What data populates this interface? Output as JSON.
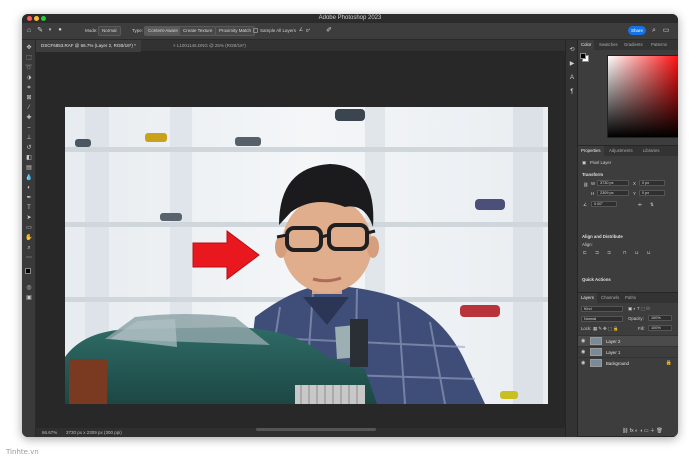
{
  "app": {
    "title": "Adobe Photoshop 2023"
  },
  "options_bar": {
    "mode_label": "Mode:",
    "mode_value": "Normal",
    "type_label": "Type:",
    "type_buttons": [
      "Content-Aware",
      "Create Texture",
      "Proximity Match"
    ],
    "sample_all_layers": "Sample All Layers",
    "angle_value": "0°",
    "share_label": "Share"
  },
  "doc_tabs": [
    {
      "label": "DSCF6853.RAF @ 66.7% (Layer 2, RGB/16*) *",
      "active": true
    },
    {
      "label": "L1001146.DNG @ 25% (RGB/16*)",
      "active": false
    }
  ],
  "status_bar": {
    "zoom": "66.67%",
    "doc_info": "3730 px x 2309 px (300 ppi)"
  },
  "color_panel": {
    "tabs": [
      "Color",
      "Swatches",
      "Gradients",
      "Patterns"
    ],
    "active_tab": "Color",
    "hue_colors": [
      "#ff0000",
      "#ff00ff",
      "#0000ff",
      "#00ffff",
      "#00ff00",
      "#ffff00",
      "#ff0000"
    ],
    "base_color": "#ff0000"
  },
  "properties_panel": {
    "tabs": [
      "Properties",
      "Adjustments",
      "Libraries"
    ],
    "active_tab": "Properties",
    "layer_type": "Pixel Layer",
    "transform_title": "Transform",
    "w_label": "W",
    "w_value": "3730 px",
    "h_label": "H",
    "h_value": "2309 px",
    "x_label": "X",
    "x_value": "0 px",
    "y_label": "Y",
    "y_value": "0 px",
    "angle_value": "0.00°",
    "align_title": "Align and Distribute",
    "align_label": "Align:",
    "quick_actions_title": "Quick Actions"
  },
  "layers_panel": {
    "tabs": [
      "Layers",
      "Channels",
      "Paths"
    ],
    "active_tab": "Layers",
    "filter_kind": "Kind",
    "blend_mode": "Normal",
    "opacity_label": "Opacity:",
    "opacity_value": "100%",
    "lock_label": "Lock:",
    "fill_label": "Fill:",
    "fill_value": "100%",
    "layers": [
      {
        "name": "Layer 2",
        "selected": true,
        "locked": false
      },
      {
        "name": "Layer 1",
        "selected": false,
        "locked": false
      },
      {
        "name": "Background",
        "selected": false,
        "locked": true
      }
    ]
  },
  "arrow_color": "#e8181e",
  "watermark": "Tinhte.vn"
}
